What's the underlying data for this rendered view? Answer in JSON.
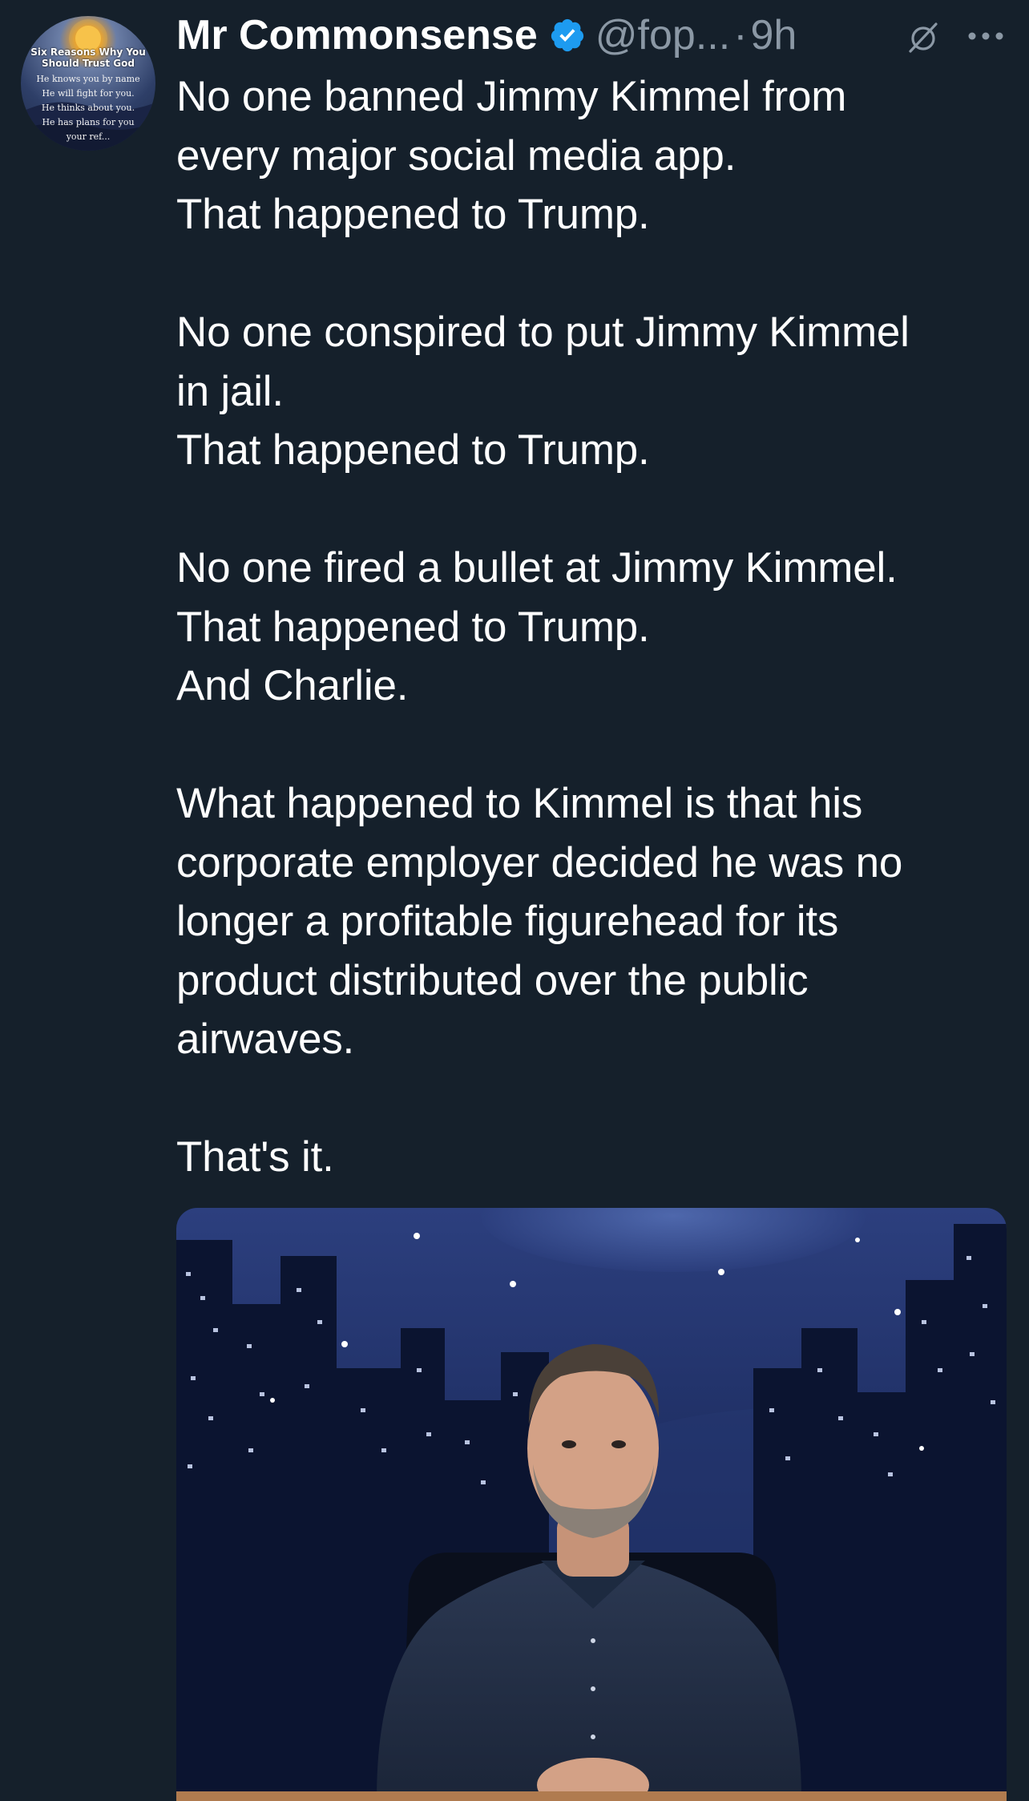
{
  "author": {
    "name": "Mr Commonsense",
    "handle": "@fop...",
    "separator": "·",
    "time": "9h",
    "verified_color": "#1d9bf0",
    "avatar": {
      "title_line1": "Six Reasons Why You",
      "title_line2": "Should Trust God",
      "lines": [
        "He knows you by name",
        "He will fight for you.",
        "He thinks about you.",
        "He has plans for you",
        "your ref..."
      ]
    }
  },
  "icons": {
    "verified": "verified-badge-icon",
    "grok": "grok-icon",
    "more": "more-options-icon"
  },
  "tweet": {
    "paragraphs": [
      [
        "No one banned Jimmy Kimmel from",
        "every major social media app.",
        "That happened to Trump."
      ],
      [
        "No one conspired to put Jimmy Kimmel",
        "in jail.",
        "That happened to Trump."
      ],
      [
        "No one fired a bullet at Jimmy Kimmel.",
        "That happened to Trump.",
        "And Charlie."
      ],
      [
        "What happened to Kimmel is that his",
        "corporate employer decided he was no",
        "longer a profitable figurehead for its",
        "product distributed over the public",
        "airwaves."
      ],
      [
        "That's it."
      ]
    ]
  },
  "media": {
    "description_icon": "photo-of-man-at-desk"
  },
  "colors": {
    "background": "#15202b",
    "text": "#ffffff",
    "secondary": "#8b98a5",
    "accent": "#1d9bf0"
  }
}
